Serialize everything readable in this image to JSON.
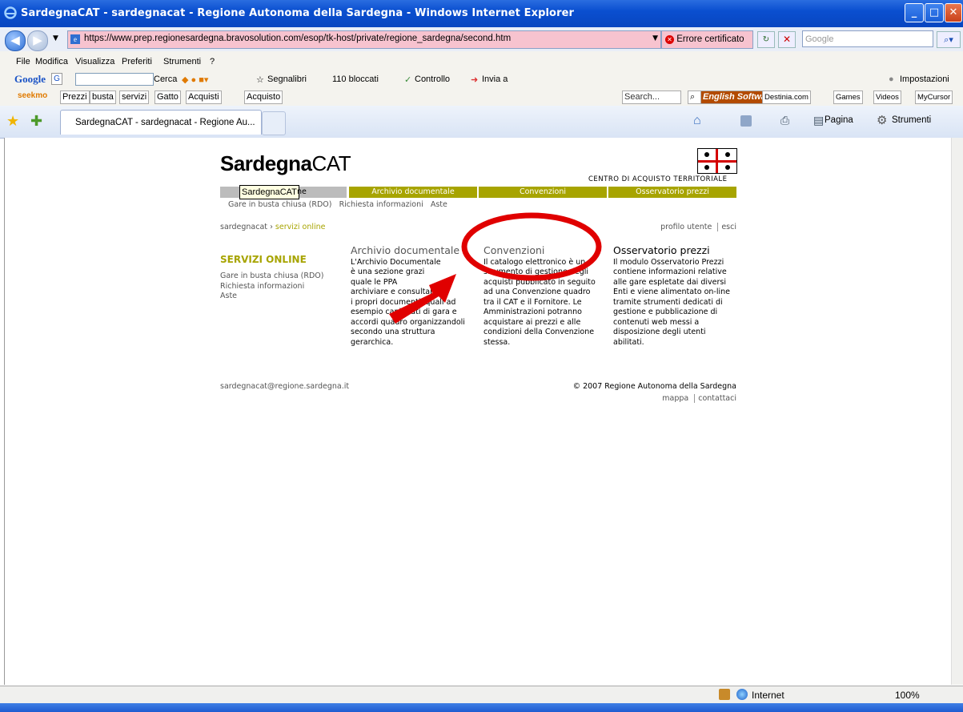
{
  "window": {
    "title": "SardegnaCAT - sardegnacat - Regione Autonoma della Sardegna - Windows Internet Explorer"
  },
  "address_bar": {
    "url": "https://www.prep.regionesardegna.bravosolution.com/esop/tk-host/private/regione_sardegna/second.htm",
    "cert_error": "Errore certificato",
    "search_placeholder": "Google"
  },
  "menu": {
    "items": [
      "File",
      "Modifica",
      "Visualizza",
      "Preferiti",
      "Strumenti",
      "?"
    ]
  },
  "google_toolbar": {
    "cerca": "Cerca",
    "segnalibri": "Segnalibri",
    "bloccati": "110 bloccati",
    "controllo": "Controllo",
    "invia": "Invia a",
    "impostazioni": "Impostazioni"
  },
  "seek_toolbar": {
    "brand": "seekmo",
    "buttons": [
      "Prezzi",
      "busta",
      "servizi",
      "Gatto",
      "Acquisti",
      "Acquisto"
    ],
    "search": "Search...",
    "links": [
      "English Software",
      "Destinia.com",
      "Games",
      "Videos",
      "MyCursor"
    ]
  },
  "tabs": {
    "active": "SardegnaCAT - sardegnacat - Regione Au..."
  },
  "command_bar": {
    "pagina": "Pagina",
    "strumenti": "Strumenti"
  },
  "site": {
    "logo_bold": "Sardegna",
    "logo_thin": "CAT",
    "subtitle": "CENTRO DI ACQUISTO TERRITORIALE",
    "tooltip": "SardegnaCAT",
    "tooltip_tail": "ne",
    "nav": [
      "Archivio documentale",
      "Convenzioni",
      "Osservatorio prezzi"
    ],
    "subnav": [
      "Gare in busta chiusa (RDO)",
      "Richiesta informazioni",
      "Aste"
    ],
    "breadcrumb_root": "sardegnacat",
    "breadcrumb_sep": "›",
    "breadcrumb_current": "servizi online",
    "profile": "profilo utente",
    "logout": "esci",
    "side_heading": "SERVIZI ONLINE",
    "side_links": [
      "Gare in busta chiusa (RDO)",
      "Richiesta informazioni",
      "Aste"
    ],
    "columns": [
      {
        "title": "Archivio documentale",
        "lines": [
          "L'Archivio Documentale",
          "è una sezione grazi",
          "quale le PPA",
          "archiviare e consultare",
          "i propri documenti, quali ad",
          "esempio capitolati di gara e",
          "accordi quadro organizzandoli",
          "secondo una struttura",
          "gerarchica."
        ]
      },
      {
        "title": "Convenzioni",
        "lines": [
          "Il catalogo elettronico è un",
          "strumento di gestione degli",
          "acquisti pubblicato in seguito",
          "ad una Convenzione quadro",
          "tra il CAT e il Fornitore. Le",
          "Amministrazioni potranno",
          "acquistare ai prezzi e alle",
          "condizioni della Convenzione",
          "stessa."
        ]
      },
      {
        "title": "Osservatorio prezzi",
        "lines": [
          "Il modulo Osservatorio Prezzi",
          "contiene informazioni relative",
          "alle gare espletate dai diversi",
          "Enti e viene alimentato on-line",
          "tramite strumenti dedicati di",
          "gestione e pubblicazione di",
          "contenuti web messi a",
          "disposizione degli utenti",
          "abilitati."
        ]
      }
    ],
    "email": "sardegnacat@regione.sardegna.it",
    "copyright": "© 2007 Regione Autonoma della Sardegna",
    "footer_links": [
      "mappa",
      "contattaci"
    ],
    "colors": {
      "olive": "#a7a400",
      "annotation_red": "#e00000"
    }
  },
  "status": {
    "zone": "Internet",
    "zoom": "100%"
  }
}
